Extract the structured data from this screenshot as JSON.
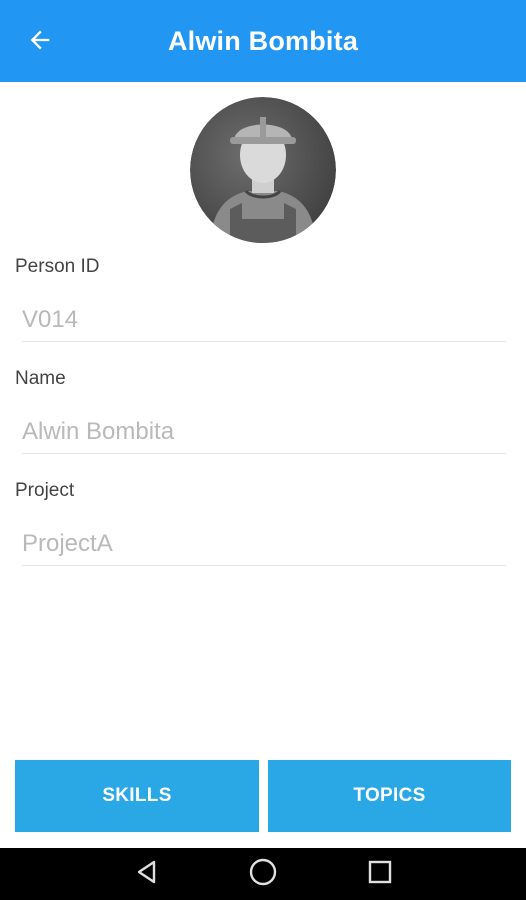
{
  "header": {
    "title": "Alwin Bombita",
    "back_icon": "arrow-left-icon",
    "background": "#2196F3"
  },
  "avatar": {
    "icon": "worker-avatar-icon"
  },
  "form": {
    "person_id": {
      "label": "Person ID",
      "value": "V014"
    },
    "name": {
      "label": "Name",
      "value": "Alwin Bombita"
    },
    "project": {
      "label": "Project",
      "value": "ProjectA"
    }
  },
  "actions": {
    "skills_label": "SKILLS",
    "topics_label": "TOPICS",
    "button_color": "#2AA8E6"
  },
  "nav_bar": {
    "back_icon": "triangle-back-icon",
    "home_icon": "circle-home-icon",
    "recents_icon": "square-recents-icon"
  }
}
